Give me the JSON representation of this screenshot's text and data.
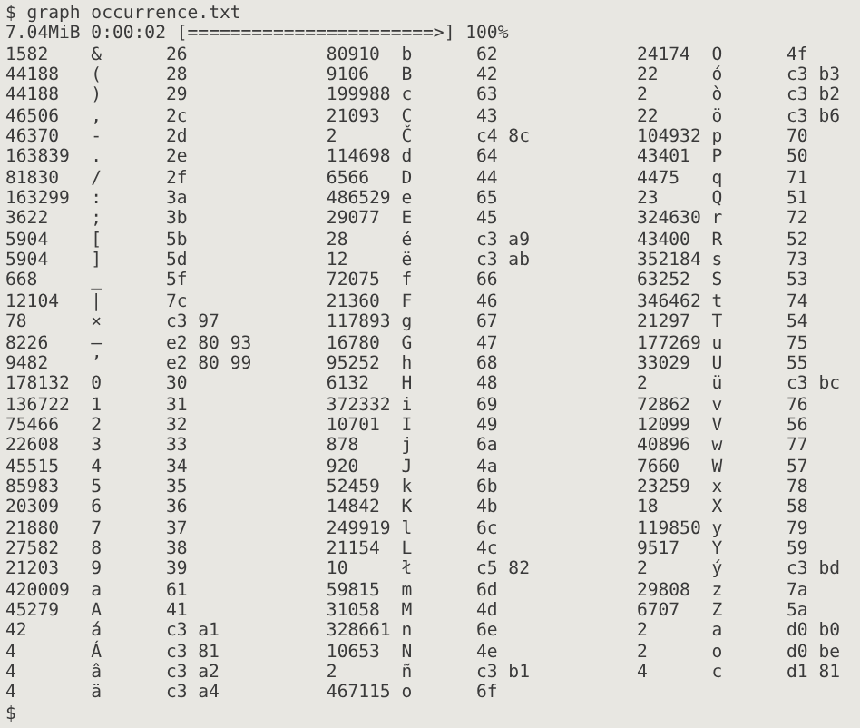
{
  "terminal": {
    "command_line": "$ graph occurrence.txt",
    "progress_line": "7.04MiB 0:00:02 [=======================>] 100%",
    "rows": [
      {
        "cells": [
          {
            "count": "1582",
            "char": "&",
            "hex": "26"
          },
          {
            "count": "80910",
            "char": "b",
            "hex": "62"
          },
          {
            "count": "24174",
            "char": "O",
            "hex": "4f"
          }
        ]
      },
      {
        "cells": [
          {
            "count": "44188",
            "char": "(",
            "hex": "28"
          },
          {
            "count": "9106",
            "char": "B",
            "hex": "42"
          },
          {
            "count": "22",
            "char": "ó",
            "hex": "c3 b3"
          }
        ]
      },
      {
        "cells": [
          {
            "count": "44188",
            "char": ")",
            "hex": "29"
          },
          {
            "count": "199988",
            "char": "c",
            "hex": "63"
          },
          {
            "count": "2",
            "char": "ò",
            "hex": "c3 b2"
          }
        ]
      },
      {
        "cells": [
          {
            "count": "46506",
            "char": ",",
            "hex": "2c"
          },
          {
            "count": "21093",
            "char": "C",
            "hex": "43"
          },
          {
            "count": "22",
            "char": "ö",
            "hex": "c3 b6"
          }
        ]
      },
      {
        "cells": [
          {
            "count": "46370",
            "char": "-",
            "hex": "2d"
          },
          {
            "count": "2",
            "char": "Č",
            "hex": "c4 8c"
          },
          {
            "count": "104932",
            "char": "p",
            "hex": "70"
          }
        ]
      },
      {
        "cells": [
          {
            "count": "163839",
            "char": ".",
            "hex": "2e"
          },
          {
            "count": "114698",
            "char": "d",
            "hex": "64"
          },
          {
            "count": "43401",
            "char": "P",
            "hex": "50"
          }
        ]
      },
      {
        "cells": [
          {
            "count": "81830",
            "char": "/",
            "hex": "2f"
          },
          {
            "count": "6566",
            "char": "D",
            "hex": "44"
          },
          {
            "count": "4475",
            "char": "q",
            "hex": "71"
          }
        ]
      },
      {
        "cells": [
          {
            "count": "163299",
            "char": ":",
            "hex": "3a"
          },
          {
            "count": "486529",
            "char": "e",
            "hex": "65"
          },
          {
            "count": "23",
            "char": "Q",
            "hex": "51"
          }
        ]
      },
      {
        "cells": [
          {
            "count": "3622",
            "char": ";",
            "hex": "3b"
          },
          {
            "count": "29077",
            "char": "E",
            "hex": "45"
          },
          {
            "count": "324630",
            "char": "r",
            "hex": "72"
          }
        ]
      },
      {
        "cells": [
          {
            "count": "5904",
            "char": "[",
            "hex": "5b"
          },
          {
            "count": "28",
            "char": "é",
            "hex": "c3 a9"
          },
          {
            "count": "43400",
            "char": "R",
            "hex": "52"
          }
        ]
      },
      {
        "cells": [
          {
            "count": "5904",
            "char": "]",
            "hex": "5d"
          },
          {
            "count": "12",
            "char": "ë",
            "hex": "c3 ab"
          },
          {
            "count": "352184",
            "char": "s",
            "hex": "73"
          }
        ]
      },
      {
        "cells": [
          {
            "count": "668",
            "char": "_",
            "hex": "5f"
          },
          {
            "count": "72075",
            "char": "f",
            "hex": "66"
          },
          {
            "count": "63252",
            "char": "S",
            "hex": "53"
          }
        ]
      },
      {
        "cells": [
          {
            "count": "12104",
            "char": "|",
            "hex": "7c"
          },
          {
            "count": "21360",
            "char": "F",
            "hex": "46"
          },
          {
            "count": "346462",
            "char": "t",
            "hex": "74"
          }
        ]
      },
      {
        "cells": [
          {
            "count": "78",
            "char": "×",
            "hex": "c3 97"
          },
          {
            "count": "117893",
            "char": "g",
            "hex": "67"
          },
          {
            "count": "21297",
            "char": "T",
            "hex": "54"
          }
        ]
      },
      {
        "cells": [
          {
            "count": "8226",
            "char": "–",
            "hex": "e2 80 93"
          },
          {
            "count": "16780",
            "char": "G",
            "hex": "47"
          },
          {
            "count": "177269",
            "char": "u",
            "hex": "75"
          }
        ]
      },
      {
        "cells": [
          {
            "count": "9482",
            "char": "’",
            "hex": "e2 80 99"
          },
          {
            "count": "95252",
            "char": "h",
            "hex": "68"
          },
          {
            "count": "33029",
            "char": "U",
            "hex": "55"
          }
        ]
      },
      {
        "cells": [
          {
            "count": "178132",
            "char": "0",
            "hex": "30"
          },
          {
            "count": "6132",
            "char": "H",
            "hex": "48"
          },
          {
            "count": "2",
            "char": "ü",
            "hex": "c3 bc"
          }
        ]
      },
      {
        "cells": [
          {
            "count": "136722",
            "char": "1",
            "hex": "31"
          },
          {
            "count": "372332",
            "char": "i",
            "hex": "69"
          },
          {
            "count": "72862",
            "char": "v",
            "hex": "76"
          }
        ]
      },
      {
        "cells": [
          {
            "count": "75466",
            "char": "2",
            "hex": "32"
          },
          {
            "count": "10701",
            "char": "I",
            "hex": "49"
          },
          {
            "count": "12099",
            "char": "V",
            "hex": "56"
          }
        ]
      },
      {
        "cells": [
          {
            "count": "22608",
            "char": "3",
            "hex": "33"
          },
          {
            "count": "878",
            "char": "j",
            "hex": "6a"
          },
          {
            "count": "40896",
            "char": "w",
            "hex": "77"
          }
        ]
      },
      {
        "cells": [
          {
            "count": "45515",
            "char": "4",
            "hex": "34"
          },
          {
            "count": "920",
            "char": "J",
            "hex": "4a"
          },
          {
            "count": "7660",
            "char": "W",
            "hex": "57"
          }
        ]
      },
      {
        "cells": [
          {
            "count": "85983",
            "char": "5",
            "hex": "35"
          },
          {
            "count": "52459",
            "char": "k",
            "hex": "6b"
          },
          {
            "count": "23259",
            "char": "x",
            "hex": "78"
          }
        ]
      },
      {
        "cells": [
          {
            "count": "20309",
            "char": "6",
            "hex": "36"
          },
          {
            "count": "14842",
            "char": "K",
            "hex": "4b"
          },
          {
            "count": "18",
            "char": "X",
            "hex": "58"
          }
        ]
      },
      {
        "cells": [
          {
            "count": "21880",
            "char": "7",
            "hex": "37"
          },
          {
            "count": "249919",
            "char": "l",
            "hex": "6c"
          },
          {
            "count": "119850",
            "char": "y",
            "hex": "79"
          }
        ]
      },
      {
        "cells": [
          {
            "count": "27582",
            "char": "8",
            "hex": "38"
          },
          {
            "count": "21154",
            "char": "L",
            "hex": "4c"
          },
          {
            "count": "9517",
            "char": "Y",
            "hex": "59"
          }
        ]
      },
      {
        "cells": [
          {
            "count": "21203",
            "char": "9",
            "hex": "39"
          },
          {
            "count": "10",
            "char": "ł",
            "hex": "c5 82"
          },
          {
            "count": "2",
            "char": "ý",
            "hex": "c3 bd"
          }
        ]
      },
      {
        "cells": [
          {
            "count": "420009",
            "char": "a",
            "hex": "61"
          },
          {
            "count": "59815",
            "char": "m",
            "hex": "6d"
          },
          {
            "count": "29808",
            "char": "z",
            "hex": "7a"
          }
        ]
      },
      {
        "cells": [
          {
            "count": "45279",
            "char": "A",
            "hex": "41"
          },
          {
            "count": "31058",
            "char": "M",
            "hex": "4d"
          },
          {
            "count": "6707",
            "char": "Z",
            "hex": "5a"
          }
        ]
      },
      {
        "cells": [
          {
            "count": "42",
            "char": "á",
            "hex": "c3 a1"
          },
          {
            "count": "328661",
            "char": "n",
            "hex": "6e"
          },
          {
            "count": "2",
            "char": "а",
            "hex": "d0 b0"
          }
        ]
      },
      {
        "cells": [
          {
            "count": "4",
            "char": "Á",
            "hex": "c3 81"
          },
          {
            "count": "10653",
            "char": "N",
            "hex": "4e"
          },
          {
            "count": "2",
            "char": "о",
            "hex": "d0 be"
          }
        ]
      },
      {
        "cells": [
          {
            "count": "4",
            "char": "â",
            "hex": "c3 a2"
          },
          {
            "count": "2",
            "char": "ñ",
            "hex": "c3 b1"
          },
          {
            "count": "4",
            "char": "с",
            "hex": "d1 81"
          }
        ]
      },
      {
        "cells": [
          {
            "count": "4",
            "char": "ä",
            "hex": "c3 a4"
          },
          {
            "count": "467115",
            "char": "o",
            "hex": "6f"
          }
        ]
      }
    ],
    "prompt": "$"
  }
}
